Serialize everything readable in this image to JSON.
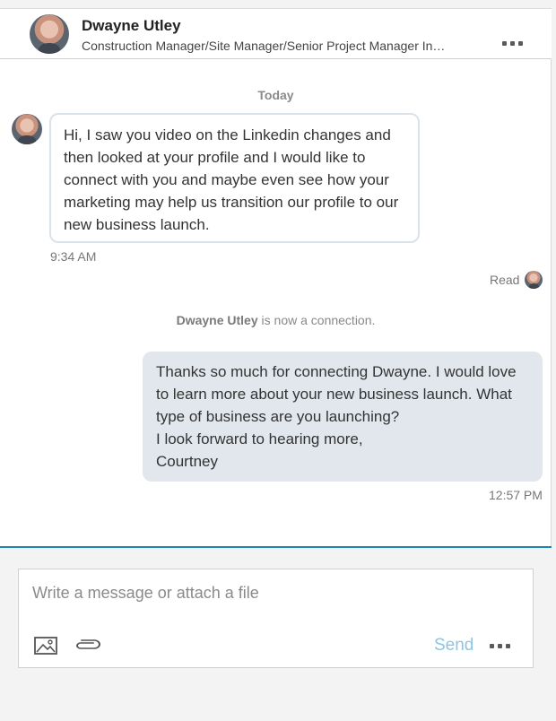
{
  "header": {
    "name": "Dwayne Utley",
    "title": "Construction Manager/Site Manager/Senior Project Manager In…"
  },
  "thread": {
    "day_label": "Today",
    "incoming": {
      "text": "Hi, I saw you video on the Linkedin changes and then looked at your profile and I would like to connect with you and maybe even see how your marketing may help us transition our profile to our new business launch.",
      "time": "9:34 AM"
    },
    "read_label": "Read",
    "connection_note": {
      "name": "Dwayne Utley",
      "text": " is now a connection."
    },
    "outgoing": {
      "lines": [
        "Thanks so much for connecting Dwayne. I would love to learn more about your new business launch. What type of business are you launching?",
        "I look forward to hearing more,",
        "Courtney"
      ],
      "time": "12:57 PM"
    }
  },
  "compose": {
    "placeholder": "Write a message or attach a file",
    "value": "",
    "send_label": "Send"
  },
  "colors": {
    "accent": "#1d86b4",
    "send_disabled": "#8ec5e1",
    "outgoing_bubble": "#e1e7ed"
  },
  "icons": [
    "avatar",
    "more-icon",
    "image-icon",
    "paperclip-icon"
  ]
}
